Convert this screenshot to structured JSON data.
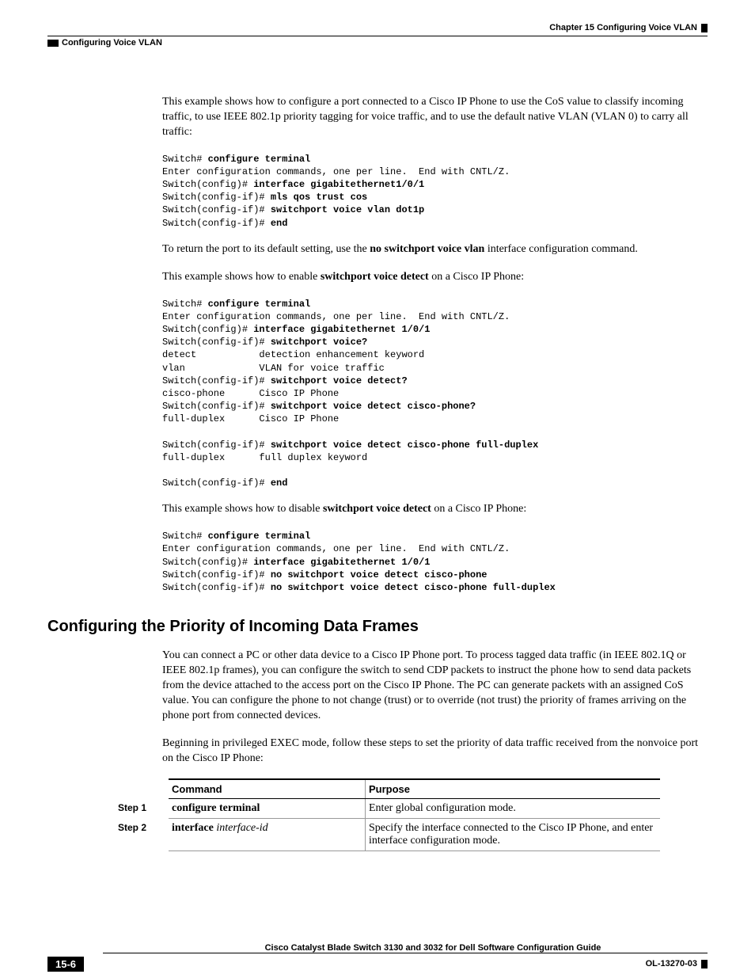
{
  "header": {
    "chapter": "Chapter 15    Configuring Voice VLAN",
    "section": "Configuring Voice VLAN"
  },
  "para1": "This example shows how to configure a port connected to a Cisco IP Phone to use the CoS value to classify incoming traffic, to use IEEE 802.1p priority tagging for voice traffic, and to use the default native VLAN (VLAN 0) to carry all traffic:",
  "code1": {
    "l1a": "Switch# ",
    "l1b": "configure terminal",
    "l2": "Enter configuration commands, one per line.  End with CNTL/Z.",
    "l3a": "Switch(config)# ",
    "l3b": "interface gigabitethernet1/0/1",
    "l4a": "Switch(config-if)# ",
    "l4b": "mls qos trust cos",
    "l5a": "Switch(config-if)# ",
    "l5b": "switchport voice vlan dot1p",
    "l6a": "Switch(config-if)# ",
    "l6b": "end"
  },
  "para2a": "To return the port to its default setting, use the ",
  "para2b": "no switchport voice vlan",
  "para2c": " interface configuration command.",
  "para3a": "This example shows how to enable ",
  "para3b": "switchport voice detect",
  "para3c": " on a Cisco IP Phone:",
  "code2": {
    "l1a": "Switch# ",
    "l1b": "configure terminal",
    "l2": "Enter configuration commands, one per line.  End with CNTL/Z.",
    "l3a": "Switch(config)# ",
    "l3b": "interface gigabitethernet 1/0/1",
    "l4a": "Switch(config-if)# ",
    "l4b": "switchport voice?",
    "l5": "detect           detection enhancement keyword",
    "l6": "vlan             VLAN for voice traffic",
    "l7a": "Switch(config-if)# ",
    "l7b": "switchport voice detect?",
    "l8": "cisco-phone      Cisco IP Phone",
    "l9a": "Switch(config-if)# ",
    "l9b": "switchport voice detect cisco-phone?",
    "l10": "full-duplex      Cisco IP Phone",
    "l11": "",
    "l12a": "Switch(config-if)# ",
    "l12b": "switchport voice detect cisco-phone full-duplex",
    "l13": "full-duplex      full duplex keyword",
    "l14": "",
    "l15a": "Switch(config-if)# ",
    "l15b": "end"
  },
  "para4a": "This example shows how to disable ",
  "para4b": "switchport voice detect",
  "para4c": " on a Cisco IP Phone:",
  "code3": {
    "l1a": "Switch# ",
    "l1b": "configure terminal",
    "l2": "Enter configuration commands, one per line.  End with CNTL/Z.",
    "l3a": "Switch(config)# ",
    "l3b": "interface gigabitethernet 1/0/1",
    "l4a": "Switch(config-if)# ",
    "l4b": "no switchport voice detect cisco-phone",
    "l5a": "Switch(config-if)# ",
    "l5b": "no switchport voice detect cisco-phone full-duplex"
  },
  "h2": "Configuring the Priority of Incoming Data Frames",
  "para5": "You can connect a PC or other data device to a Cisco IP Phone port. To process tagged data traffic (in IEEE 802.1Q or IEEE 802.1p frames), you can configure the switch to send CDP packets to instruct the phone how to send data packets from the device attached to the access port on the Cisco IP Phone. The PC can generate packets with an assigned CoS value. You can configure the phone to not change (trust) or to override (not trust) the priority of frames arriving on the phone port from connected devices.",
  "para6": "Beginning in privileged EXEC mode, follow these steps to set the priority of data traffic received from the nonvoice port on the Cisco IP Phone:",
  "table": {
    "head": {
      "command": "Command",
      "purpose": "Purpose"
    },
    "rows": [
      {
        "step": "Step 1",
        "cmd_b": "configure terminal",
        "cmd_i": "",
        "purpose": "Enter global configuration mode."
      },
      {
        "step": "Step 2",
        "cmd_b": "interface ",
        "cmd_i": "interface-id",
        "purpose": "Specify the interface connected to the Cisco IP Phone, and enter interface configuration mode."
      }
    ]
  },
  "footer": {
    "title": "Cisco Catalyst Blade Switch 3130 and 3032 for Dell Software Configuration Guide",
    "page": "15-6",
    "docid": "OL-13270-03"
  }
}
